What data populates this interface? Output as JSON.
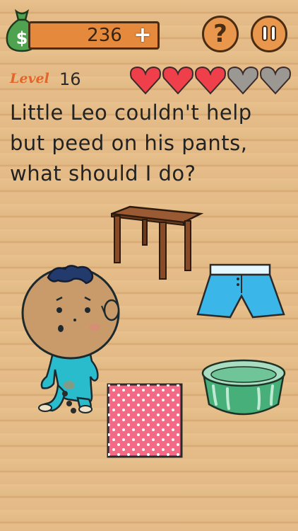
{
  "hud": {
    "coins": "236",
    "coins_icon": "dollar-moneybag",
    "help_label": "?",
    "hearts_total": 5,
    "hearts_filled": 3
  },
  "level": {
    "label": "Level",
    "number": "16"
  },
  "question": "Little Leo couldn't help but peed on his pants, what should I do?",
  "items": [
    "table-icon",
    "pants-icon",
    "baby-character",
    "pink-towel-icon",
    "basin-icon"
  ],
  "colors": {
    "heart_full": "#ee3f4a",
    "heart_empty": "#9b9793",
    "accent_orange": "#e58a3c",
    "level_orange": "#e2662a"
  }
}
